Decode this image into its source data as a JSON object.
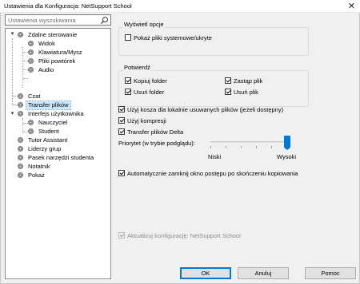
{
  "window": {
    "title": "Ustawienia dla Konfiguracja: NetSupport School",
    "close_symbol": "✕"
  },
  "search": {
    "placeholder": "Ustawienia wyszukiwania",
    "value": ""
  },
  "tree": [
    {
      "label": "Zdalne sterowanie",
      "expander": "▾"
    },
    {
      "label": "Widok"
    },
    {
      "label": "Klawiatura/Mysz"
    },
    {
      "label": "Pliki powtórek"
    },
    {
      "label": "Audio"
    },
    {
      "label": "Czat"
    },
    {
      "label": "Transfer plików"
    },
    {
      "label": "Interfejs użytkownika",
      "expander": "▾"
    },
    {
      "label": "Nauczyciel"
    },
    {
      "label": "Student"
    },
    {
      "label": "Tutor Assistant"
    },
    {
      "label": "Liderzy grup"
    },
    {
      "label": "Pasek narzędzi studenta"
    },
    {
      "label": "Notatnik"
    },
    {
      "label": "Pokaż"
    }
  ],
  "view_options": {
    "title": "Wyświetl opcje",
    "show_system_files": {
      "label": "Pokaż pliki systemowe/ukryte",
      "checked": false
    }
  },
  "confirm": {
    "title": "Potwierdź",
    "copy_folder": {
      "label": "Kopiuj folder",
      "checked": true
    },
    "replace_file": {
      "label": "Zastąp plik",
      "checked": true
    },
    "delete_folder": {
      "label": "Usuń folder",
      "checked": true
    },
    "delete_file": {
      "label": "Usuń plik",
      "checked": true
    }
  },
  "options": {
    "recycle_bin": {
      "label": "Użyj kosza dla lokalnie usuwanych plików (jeżeli dostępny)",
      "checked": true
    },
    "compression": {
      "label": "Użyj kompresji",
      "checked": true
    },
    "delta": {
      "label": "Transfer plików Delta",
      "checked": true
    }
  },
  "priority": {
    "label": "Priorytet (w trybie podglądu):",
    "min_label": "Niski",
    "max_label": "Wysoki",
    "value": 1.0
  },
  "auto_close": {
    "label": "Automatycznie zamknij okno postępu po skończeniu kopiowania",
    "checked": true
  },
  "update_config": {
    "label": "Aktualizuj konfigurację: NetSupport School",
    "checked": true,
    "disabled": true
  },
  "buttons": {
    "ok": "OK",
    "cancel": "Anuluj",
    "help": "Pomoc"
  },
  "colors": {
    "accent": "#0078d7",
    "selection": "#cce8ff"
  }
}
